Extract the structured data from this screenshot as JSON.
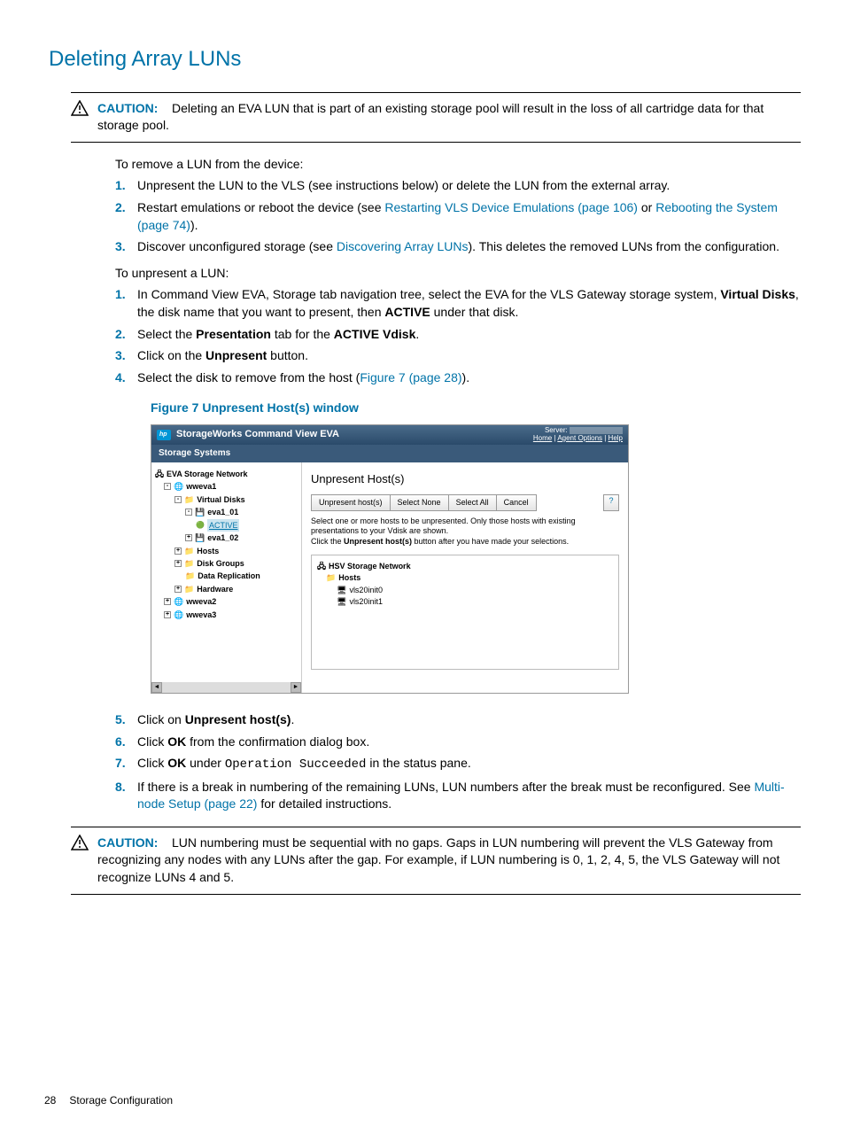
{
  "page_title": "Deleting Array LUNs",
  "caution1": {
    "label": "CAUTION:",
    "text": "Deleting an EVA LUN that is part of an existing storage pool will result in the loss of all cartridge data for that storage pool."
  },
  "remove_intro": "To remove a LUN from the device:",
  "remove_steps": {
    "s1": "Unpresent the LUN to the VLS (see instructions below) or delete the LUN from the external array.",
    "s2_a": "Restart emulations or reboot the device (see ",
    "s2_link1": "Restarting VLS Device Emulations (page 106)",
    "s2_b": " or ",
    "s2_link2": "Rebooting the System (page 74)",
    "s2_c": ").",
    "s3_a": "Discover unconfigured storage (see ",
    "s3_link": "Discovering Array LUNs",
    "s3_b": "). This deletes the removed LUNs from the configuration."
  },
  "unpresent_intro": "To unpresent a LUN:",
  "unpresent_steps": {
    "s1_a": "In Command View EVA, Storage tab navigation tree, select the EVA for the VLS Gateway storage system, ",
    "s1_b1": "Virtual Disks",
    "s1_c": ", the disk name that you want to present, then ",
    "s1_b2": "ACTIVE",
    "s1_d": " under that disk.",
    "s2_a": "Select the ",
    "s2_b1": "Presentation",
    "s2_c": " tab for the ",
    "s2_b2": "ACTIVE Vdisk",
    "s2_d": ".",
    "s3_a": "Click on the ",
    "s3_b": "Unpresent",
    "s3_c": " button.",
    "s4_a": "Select the disk to remove from the host (",
    "s4_link": "Figure 7 (page 28)",
    "s4_b": ")."
  },
  "figure_caption": "Figure 7 Unpresent Host(s) window",
  "screenshot": {
    "header_title": "StorageWorks Command View EVA",
    "server_label": "Server:",
    "header_links": {
      "home": "Home",
      "agent": "Agent Options",
      "help": "Help"
    },
    "tab": "Storage Systems",
    "nav": {
      "root": "EVA Storage Network",
      "wweva1": "wweva1",
      "vdisks": "Virtual Disks",
      "eva1_01": "eva1_01",
      "active": "ACTIVE",
      "eva1_02": "eva1_02",
      "hosts": "Hosts",
      "diskgroups": "Disk Groups",
      "datarepl": "Data Replication",
      "hardware": "Hardware",
      "wweva2": "wweva2",
      "wweva3": "wweva3"
    },
    "main": {
      "title": "Unpresent Host(s)",
      "btn_unpresent": "Unpresent host(s)",
      "btn_none": "Select None",
      "btn_all": "Select All",
      "btn_cancel": "Cancel",
      "help": "?",
      "instruct1": "Select one or more hosts to be unpresented. Only those hosts with existing presentations to your Vdisk are shown.",
      "instruct2a": "Click the ",
      "instruct2b": "Unpresent host(s)",
      "instruct2c": " button after you have made your selections.",
      "tree_root": "HSV Storage Network",
      "tree_hosts": "Hosts",
      "tree_h1": "vls20init0",
      "tree_h2": "vls20init1"
    }
  },
  "post_steps": {
    "s5_a": "Click on ",
    "s5_b": "Unpresent host(s)",
    "s5_c": ".",
    "s6_a": "Click ",
    "s6_b": "OK",
    "s6_c": " from the confirmation dialog box.",
    "s7_a": "Click ",
    "s7_b": "OK",
    "s7_c": " under ",
    "s7_code": "Operation Succeeded",
    "s7_d": " in the status pane.",
    "s8_a": "If there is a break in numbering of the remaining LUNs, LUN numbers after the break must be reconfigured. See ",
    "s8_link": "Multi-node Setup (page 22)",
    "s8_b": " for detailed instructions."
  },
  "caution2": {
    "label": "CAUTION:",
    "text": "LUN numbering must be sequential with no gaps. Gaps in LUN numbering will prevent the VLS Gateway from recognizing any nodes with any LUNs after the gap. For example, if LUN numbering is 0, 1, 2, 4, 5, the VLS Gateway will not recognize LUNs 4 and 5."
  },
  "footer": {
    "page": "28",
    "section": "Storage Configuration"
  }
}
